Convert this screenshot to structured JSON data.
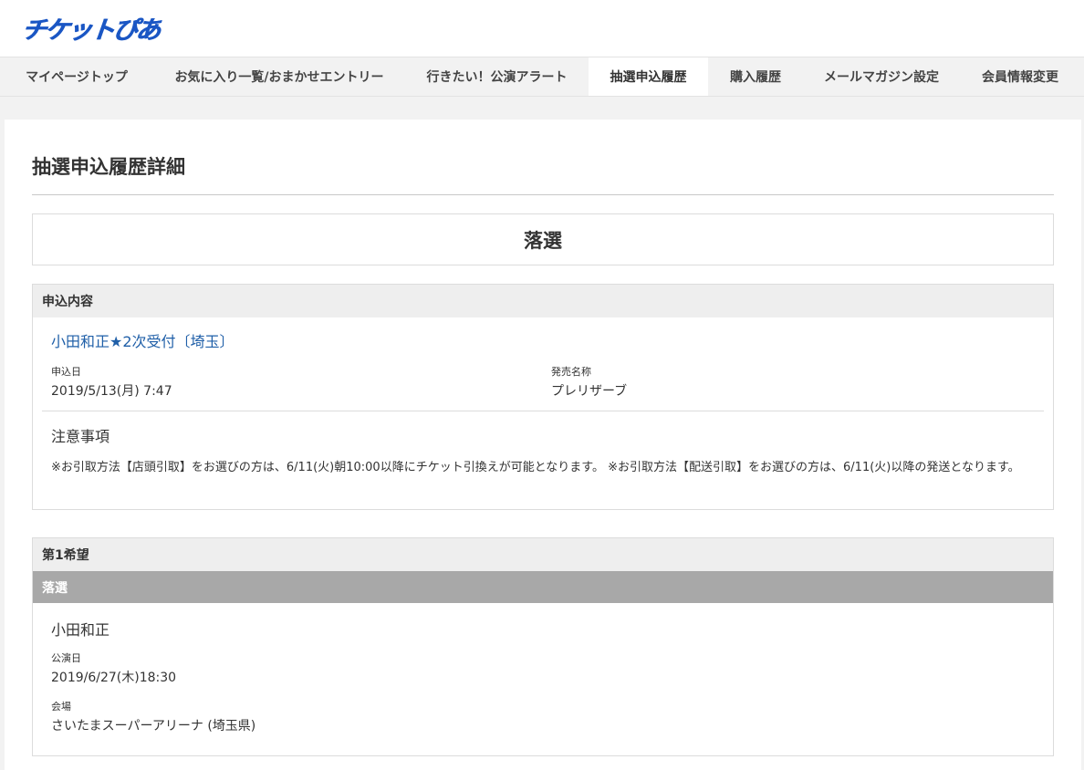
{
  "site": {
    "logo": "チケットぴあ"
  },
  "nav": [
    {
      "label": "マイページトップ",
      "active": false
    },
    {
      "label": "お気に入り一覧/おまかせエントリー",
      "active": false
    },
    {
      "label": "行きたい！公演アラート",
      "active": false
    },
    {
      "label": "抽選申込履歴",
      "active": true
    },
    {
      "label": "購入履歴",
      "active": false
    },
    {
      "label": "メールマガジン設定",
      "active": false
    },
    {
      "label": "会員情報変更",
      "active": false
    }
  ],
  "page": {
    "title": "抽選申込履歴詳細",
    "result": "落選"
  },
  "application": {
    "heading": "申込内容",
    "event_name": "小田和正★2次受付〔埼玉〕",
    "date_label": "申込日",
    "date_value": "2019/5/13(月) 7:47",
    "sale_label": "発売名称",
    "sale_value": "プレリザーブ",
    "notes_title": "注意事項",
    "notes_body": "※お引取方法【店頭引取】をお選びの方は、6/11(火)朝10:00以降にチケット引換えが可能となります。 ※お引取方法【配送引取】をお選びの方は、6/11(火)以降の発送となります。"
  },
  "choice1": {
    "heading": "第1希望",
    "status": "落選",
    "performance_name": "小田和正",
    "perf_date_label": "公演日",
    "perf_date_value": "2019/6/27(木)18:30",
    "venue_label": "会場",
    "venue_value": "さいたまスーパーアリーナ (埼玉県)"
  }
}
